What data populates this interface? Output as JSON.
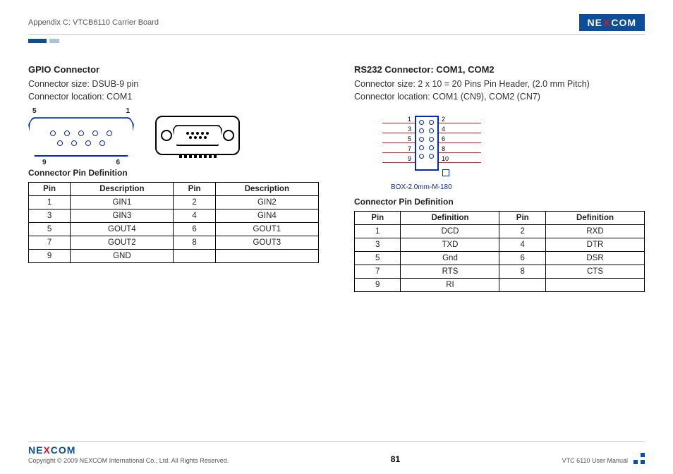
{
  "header": {
    "title": "Appendix C: VTCB6110 Carrier Board",
    "logo": "NEXCOM"
  },
  "left": {
    "title": "GPIO Connector",
    "size": "Connector size: DSUB-9 pin",
    "loc": "Connector location: COM1",
    "pinlabels": {
      "tl": "5",
      "tr": "1",
      "bl": "9",
      "br": "6"
    },
    "tableTitle": "Connector Pin Definition",
    "headers": {
      "pin": "Pin",
      "desc": "Description"
    },
    "rows": [
      {
        "p1": "1",
        "d1": "GIN1",
        "p2": "2",
        "d2": "GIN2"
      },
      {
        "p1": "3",
        "d1": "GIN3",
        "p2": "4",
        "d2": "GIN4"
      },
      {
        "p1": "5",
        "d1": "GOUT4",
        "p2": "6",
        "d2": "GOUT1"
      },
      {
        "p1": "7",
        "d1": "GOUT2",
        "p2": "8",
        "d2": "GOUT3"
      },
      {
        "p1": "9",
        "d1": "GND",
        "p2": "",
        "d2": ""
      }
    ]
  },
  "right": {
    "title": "RS232 Connector: COM1, COM2",
    "size": "Connector size: 2 x 10 = 20 Pins Pin Header, (2.0 mm Pitch)",
    "loc": "Connector location: COM1 (CN9), COM2 (CN7)",
    "boxLabel": "BOX-2.0mm-M-180",
    "nums": {
      "l": [
        "1",
        "3",
        "5",
        "7",
        "9"
      ],
      "r": [
        "2",
        "4",
        "6",
        "8",
        "10"
      ]
    },
    "tableTitle": "Connector Pin Definition",
    "headers": {
      "pin": "Pin",
      "def": "Definition"
    },
    "rows": [
      {
        "p1": "1",
        "d1": "DCD",
        "p2": "2",
        "d2": "RXD"
      },
      {
        "p1": "3",
        "d1": "TXD",
        "p2": "4",
        "d2": "DTR"
      },
      {
        "p1": "5",
        "d1": "Gnd",
        "p2": "6",
        "d2": "DSR"
      },
      {
        "p1": "7",
        "d1": "RTS",
        "p2": "8",
        "d2": "CTS"
      },
      {
        "p1": "9",
        "d1": "RI",
        "p2": "",
        "d2": ""
      }
    ]
  },
  "footer": {
    "logo": "NEXCOM",
    "copyright": "Copyright © 2009 NEXCOM International Co., Ltd. All Rights Reserved.",
    "page": "81",
    "doc": "VTC 6110 User Manual"
  }
}
